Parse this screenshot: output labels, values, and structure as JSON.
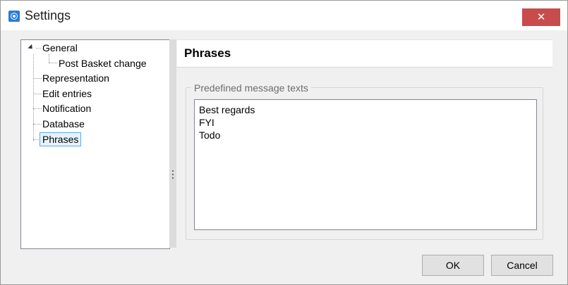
{
  "window": {
    "title": "Settings",
    "close_glyph": "✕",
    "icon": "app-logo-icon",
    "accent_close": "#c94c4c"
  },
  "tree": {
    "items": [
      {
        "label": "General",
        "expanded": true
      },
      {
        "label": "Post Basket change",
        "parent": "General"
      },
      {
        "label": "Representation"
      },
      {
        "label": "Edit entries"
      },
      {
        "label": "Notification"
      },
      {
        "label": "Database"
      },
      {
        "label": "Phrases",
        "selected": true
      }
    ]
  },
  "content": {
    "header_title": "Phrases",
    "group_label": "Predefined message texts",
    "phrases": [
      "Best regards",
      "FYI",
      "Todo"
    ]
  },
  "buttons": {
    "ok": "OK",
    "cancel": "Cancel"
  }
}
